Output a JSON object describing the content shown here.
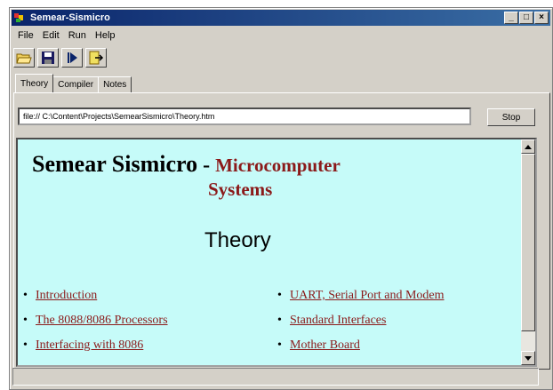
{
  "window": {
    "title": "Semear-Sismicro"
  },
  "menu": [
    {
      "label": "File"
    },
    {
      "label": "Edit"
    },
    {
      "label": "Run"
    },
    {
      "label": "Help"
    }
  ],
  "toolbar": {
    "icons": [
      "open-folder-icon",
      "save-icon",
      "run-icon",
      "exit-icon"
    ]
  },
  "tabs": [
    {
      "label": "Theory",
      "active": true
    },
    {
      "label": "Compiler",
      "active": false
    },
    {
      "label": "Notes",
      "active": false
    }
  ],
  "address": {
    "value": "file:// C:\\Content\\Projects\\SemearSismicro\\Theory.htm",
    "stop_label": "Stop"
  },
  "page": {
    "title_main": "Semear Sismicro",
    "title_dash": " - ",
    "title_sub_1": "Microcomputer",
    "title_sub_2": "Systems",
    "subtitle": "Theory",
    "links_left": [
      "Introduction",
      "The 8088/8086 Processors",
      "Interfacing with 8086"
    ],
    "links_right": [
      "UART, Serial Port and Modem",
      "Standard Interfaces",
      "Mother Board"
    ]
  },
  "colors": {
    "content_bg": "#c6fbf9",
    "title_accent": "#8b1a1a",
    "titlebar": "#0a246a"
  }
}
